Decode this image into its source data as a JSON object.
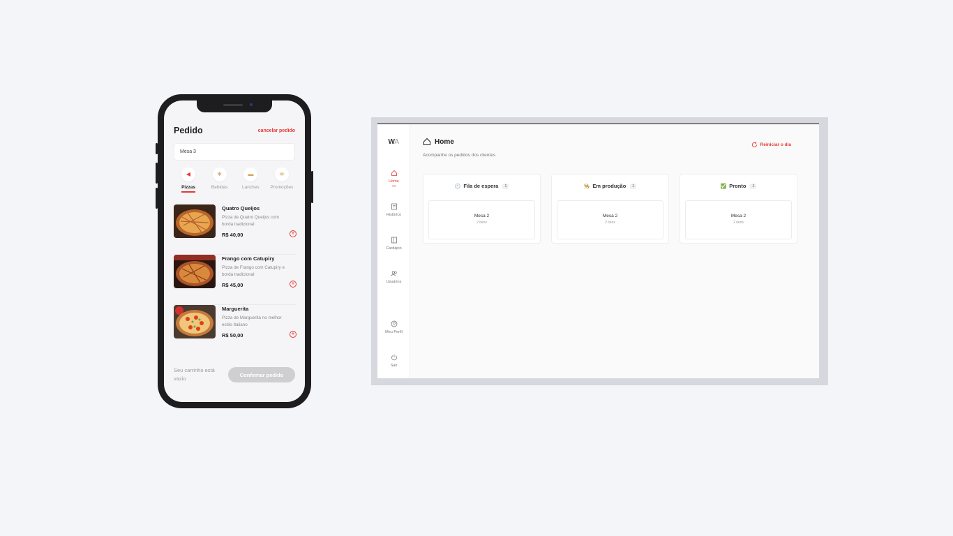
{
  "mobile": {
    "title": "Pedido",
    "cancel_label": "cancelar pedido",
    "table_input_value": "Mesa 3",
    "categories": [
      {
        "label": "Pizzas",
        "icon": "pizza-icon",
        "active": true
      },
      {
        "label": "Bebidas",
        "icon": "drink-icon",
        "active": false
      },
      {
        "label": "Lanches",
        "icon": "burger-icon",
        "active": false
      },
      {
        "label": "Promoções",
        "icon": "promo-icon",
        "active": false
      }
    ],
    "products": [
      {
        "name": "Quatro Queijos",
        "description": "Pizza de Quatro Queijos com borda tradicional",
        "price": "R$ 40,00"
      },
      {
        "name": "Frango com Catupiry",
        "description": "Pizza de Frango com Catupiry e borda tradicional",
        "price": "R$ 45,00"
      },
      {
        "name": "Marguerita",
        "description": "Pizza de Marguerita no melhor estilo Italiano",
        "price": "R$ 50,00"
      }
    ],
    "cart_status": "Seu carrinho está vazio",
    "confirm_label": "Confirmar pedido"
  },
  "dashboard": {
    "logo_bold": "W",
    "logo_light": "A",
    "nav": [
      {
        "label": "Home",
        "icon": "home-icon",
        "active": true
      },
      {
        "label": "Histórico",
        "icon": "history-icon",
        "active": false
      },
      {
        "label": "Cardápio",
        "icon": "menu-book-icon",
        "active": false
      },
      {
        "label": "Usuários",
        "icon": "users-icon",
        "active": false
      },
      {
        "label": "Meu Perfil",
        "icon": "profile-icon",
        "active": false
      },
      {
        "label": "Sair",
        "icon": "power-icon",
        "active": false
      }
    ],
    "page_title": "Home",
    "page_subtitle": "Acompanhe os pedidos dos clientes",
    "restart_label": "Reiniciar o dia",
    "columns": [
      {
        "title": "Fila de espera",
        "emoji": "🕘",
        "count": "1",
        "orders": [
          {
            "table": "Mesa 2",
            "items": "2 itens"
          }
        ]
      },
      {
        "title": "Em produção",
        "emoji": "👨‍🍳",
        "count": "1",
        "orders": [
          {
            "table": "Mesa 2",
            "items": "2 itens"
          }
        ]
      },
      {
        "title": "Pronto",
        "emoji": "✅",
        "count": "1",
        "orders": [
          {
            "table": "Mesa 2",
            "items": "2 itens"
          }
        ]
      }
    ],
    "colors": {
      "accent": "#e53935",
      "background": "#fafafa"
    }
  }
}
